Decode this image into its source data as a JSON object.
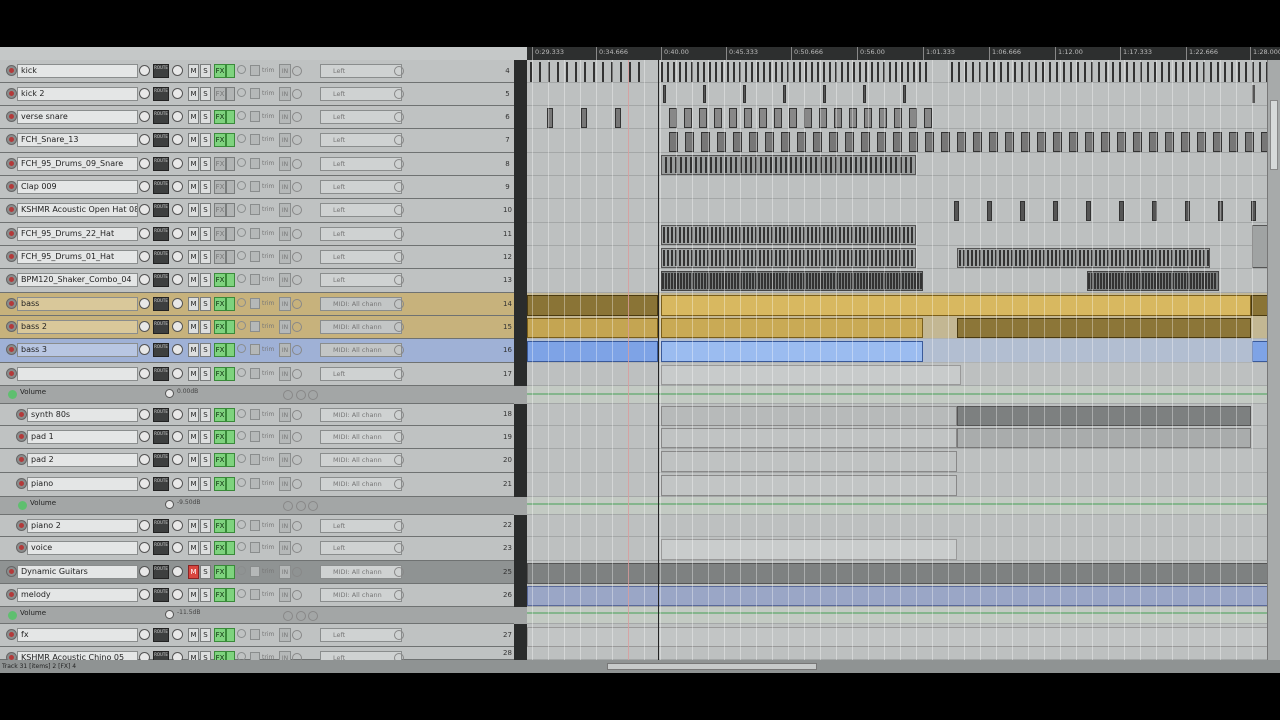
{
  "ruler": {
    "ticks": [
      "0:29.333",
      "0:34.666",
      "0:40.00",
      "0:45.333",
      "0:50.666",
      "0:56.00",
      "1:01.333",
      "1:06.666",
      "1:12.00",
      "1:17.333",
      "1:22.666",
      "1:28.000"
    ]
  },
  "tracks": [
    {
      "id": "t4",
      "name": "kick",
      "num": "4",
      "input": "Left",
      "fx": true
    },
    {
      "id": "t5",
      "name": "kick 2",
      "num": "5",
      "input": "Left",
      "fx": false
    },
    {
      "id": "t6",
      "name": "verse snare",
      "num": "6",
      "input": "Left",
      "fx": true
    },
    {
      "id": "t7",
      "name": "FCH_Snare_13",
      "num": "7",
      "input": "Left",
      "fx": true
    },
    {
      "id": "t8",
      "name": "FCH_95_Drums_09_Snare",
      "num": "8",
      "input": "Left",
      "fx": false
    },
    {
      "id": "t9",
      "name": "Clap 009",
      "num": "9",
      "input": "Left",
      "fx": false
    },
    {
      "id": "t10",
      "name": "KSHMR Acoustic Open Hat 08",
      "num": "10",
      "input": "Left",
      "fx": false
    },
    {
      "id": "t11",
      "name": "FCH_95_Drums_22_Hat",
      "num": "11",
      "input": "Left",
      "fx": false
    },
    {
      "id": "t12",
      "name": "FCH_95_Drums_01_Hat",
      "num": "12",
      "input": "Left",
      "fx": false
    },
    {
      "id": "t13",
      "name": "BPM120_Shaker_Combo_04",
      "num": "13",
      "input": "Left",
      "fx": true
    },
    {
      "id": "t14",
      "name": "bass",
      "num": "14",
      "input": "MIDI: All chann",
      "fx": true
    },
    {
      "id": "t15",
      "name": "bass 2",
      "num": "15",
      "input": "MIDI: All chann",
      "fx": true
    },
    {
      "id": "t16",
      "name": "bass 3",
      "num": "16",
      "input": "MIDI: All chann",
      "fx": true
    },
    {
      "id": "t17",
      "name": "",
      "num": "17",
      "input": "Left",
      "fx": true
    },
    {
      "id": "t18",
      "name": "synth 80s",
      "num": "18",
      "input": "MIDI: All chann",
      "fx": true
    },
    {
      "id": "t19",
      "name": "pad 1",
      "num": "19",
      "input": "MIDI: All chann",
      "fx": true
    },
    {
      "id": "t20",
      "name": "pad 2",
      "num": "20",
      "input": "MIDI: All chann",
      "fx": true
    },
    {
      "id": "t21",
      "name": "piano",
      "num": "21",
      "input": "MIDI: All chann",
      "fx": true
    },
    {
      "id": "t22",
      "name": "piano 2",
      "num": "22",
      "input": "Left",
      "fx": true
    },
    {
      "id": "t23",
      "name": "voice",
      "num": "23",
      "input": "Left",
      "fx": true
    },
    {
      "id": "t25",
      "name": "Dynamic Guitars",
      "num": "25",
      "input": "MIDI: All chann",
      "fx": true
    },
    {
      "id": "t26",
      "name": "melody",
      "num": "26",
      "input": "MIDI: All chann",
      "fx": true
    },
    {
      "id": "t27",
      "name": "fx",
      "num": "27",
      "input": "Left",
      "fx": true
    },
    {
      "id": "t28",
      "name": "KSHMR Acoustic Chino 05",
      "num": "28",
      "input": "Left",
      "fx": true
    }
  ],
  "envelopes": [
    {
      "label": "Volume",
      "value": "0.00dB"
    },
    {
      "label": "Volume",
      "value": "-9.50dB"
    },
    {
      "label": "Volume",
      "value": "-11.5dB"
    }
  ],
  "buttons": {
    "route": "ROUTE",
    "mute": "M",
    "solo": "S",
    "fx": "FX",
    "trim": "trim",
    "in": "IN"
  },
  "status": "Track 31 [items] 2 [FX] 4",
  "colors": {
    "gold": "#c7a34a",
    "blue": "#7ea3e6",
    "fx_green": "#7ed37e",
    "mute_red": "#d9473f"
  }
}
